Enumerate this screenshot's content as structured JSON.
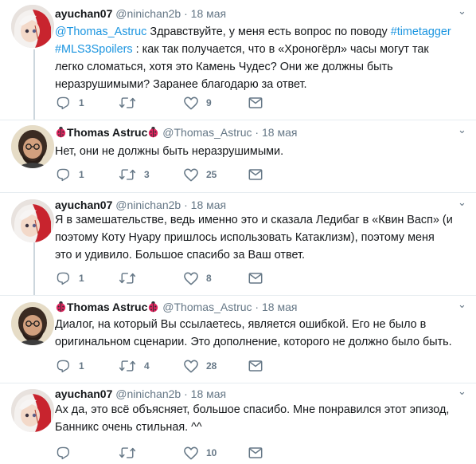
{
  "tweets": [
    {
      "name": "ayuchan07",
      "handle": "@ninichan2b",
      "dot": "·",
      "date": "18 мая",
      "text_segments": [
        {
          "text": "@Thomas_Astruc",
          "link": true
        },
        {
          "text": " Здравствуйте, у меня есть вопрос по поводу ",
          "link": false
        },
        {
          "text": "#timetagger",
          "link": true
        },
        {
          "text": " ",
          "link": false
        },
        {
          "text": "#MLS3Spoilers",
          "link": true
        },
        {
          "text": " : как так получается, что в «Хроногёрл» часы могут так легко сломаться, хотя это Камень Чудес? Они же должны быть неразрушимыми? Заранее благодарю за ответ.",
          "link": false
        }
      ],
      "replies": "1",
      "retweets": "",
      "likes": "9"
    },
    {
      "name": "Thomas Astruc",
      "handle": "@Thomas_Astruc",
      "dot": "·",
      "date": "18 мая",
      "text_segments": [
        {
          "text": "Нет, они не должны быть неразрушимыми.",
          "link": false
        }
      ],
      "replies": "1",
      "retweets": "3",
      "likes": "25"
    },
    {
      "name": "ayuchan07",
      "handle": "@ninichan2b",
      "dot": "·",
      "date": "18 мая",
      "text_segments": [
        {
          "text": "Я в замешательстве, ведь именно это и сказала Ледибаг в «Квин Васп» (и поэтому Коту Нуару пришлось использовать Катаклизм), поэтому меня это и удивило. Большое спасибо за Ваш ответ.",
          "link": false
        }
      ],
      "replies": "1",
      "retweets": "",
      "likes": "8"
    },
    {
      "name": "Thomas Astruc",
      "handle": "@Thomas_Astruc",
      "dot": "·",
      "date": "18 мая",
      "text_segments": [
        {
          "text": "Диалог, на который Вы ссылаетесь, является ошибкой. Его не было в оригинальном сценарии. Это дополнение, которого не должно было быть.",
          "link": false
        }
      ],
      "replies": "1",
      "retweets": "4",
      "likes": "28"
    },
    {
      "name": "ayuchan07",
      "handle": "@ninichan2b",
      "dot": "·",
      "date": "18 мая",
      "text_segments": [
        {
          "text": "Ах да, это всё объясняет, большое спасибо. Мне понравился этот эпизод, Банникс очень стильная. ^^",
          "link": false
        }
      ],
      "replies": "",
      "retweets": "",
      "likes": "10"
    }
  ],
  "icons": {
    "reply": "reply-icon",
    "retweet": "retweet-icon",
    "like": "heart-icon",
    "dm": "envelope-icon",
    "caret": "chevron-down-icon",
    "ladybug": "ladybug-emoji-icon"
  },
  "colors": {
    "link": "#1b95e0",
    "secondary": "#657786",
    "separator": "#e6ecf0",
    "thread_line": "#ccd6dd",
    "ladybug": "#e0245e"
  },
  "caret_glyph": "⌄"
}
